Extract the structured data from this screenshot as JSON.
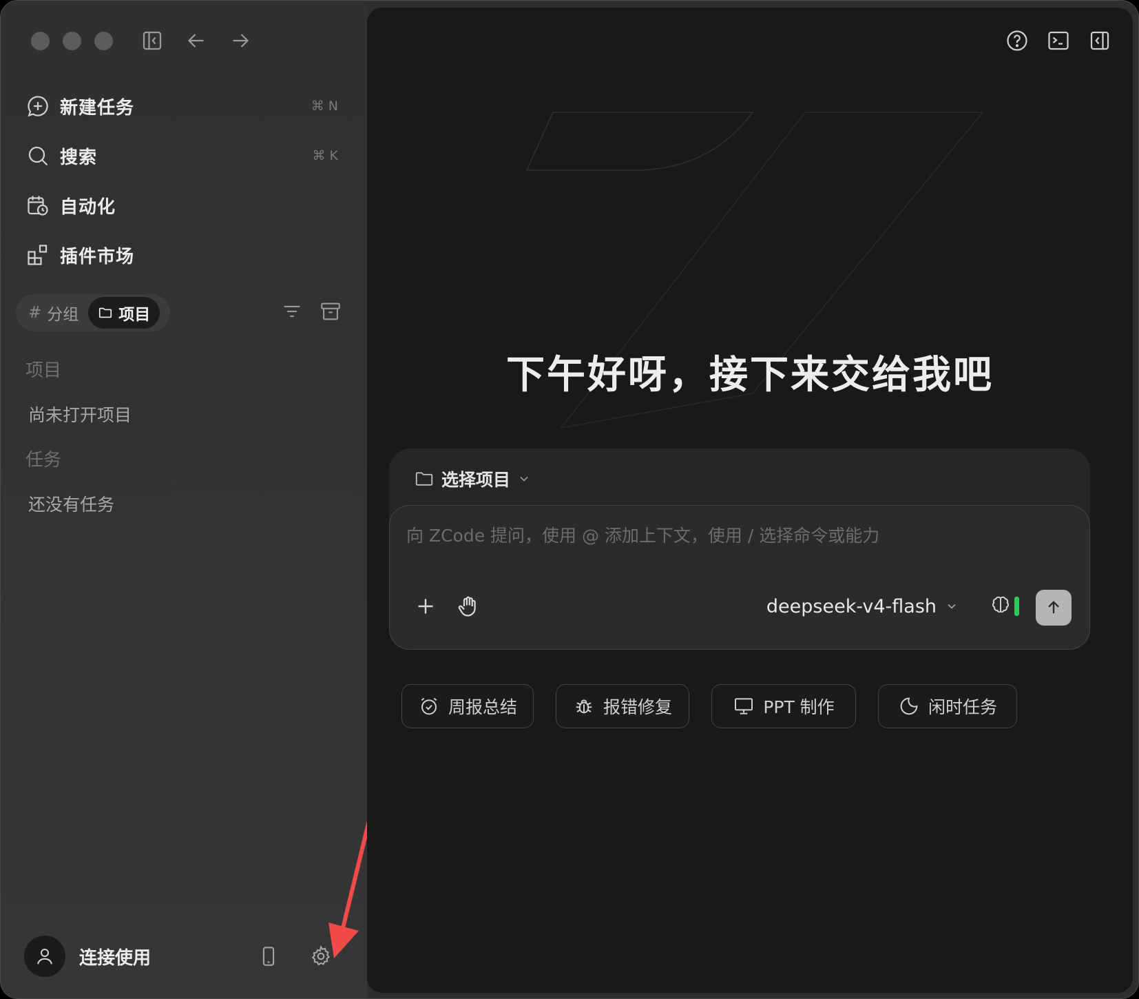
{
  "sidebar": {
    "nav": [
      {
        "label": "新建任务",
        "shortcut": "⌘ N",
        "icon": "new-task-icon"
      },
      {
        "label": "搜索",
        "shortcut": "⌘ K",
        "icon": "search-icon"
      },
      {
        "label": "自动化",
        "shortcut": "",
        "icon": "calendar-clock-icon"
      },
      {
        "label": "插件市场",
        "shortcut": "",
        "icon": "plugin-grid-icon"
      }
    ],
    "segment": {
      "group_label": "分组",
      "project_label": "项目",
      "active": "项目"
    },
    "projects_title": "项目",
    "projects_empty": "尚未打开项目",
    "tasks_title": "任务",
    "tasks_empty": "还没有任务",
    "account_label": "连接使用"
  },
  "main": {
    "greeting": "下午好呀，接下来交给我吧",
    "composer": {
      "project_select": "选择项目",
      "placeholder": "向 ZCode 提问，使用 @ 添加上下文，使用 / 选择命令或能力",
      "model": "deepseek-v4-flash"
    },
    "suggestions": [
      {
        "label": "周报总结",
        "icon": "alarm-clock-icon"
      },
      {
        "label": "报错修复",
        "icon": "bug-icon"
      },
      {
        "label": "PPT 制作",
        "icon": "presentation-icon"
      },
      {
        "label": "闲时任务",
        "icon": "moon-icon"
      }
    ]
  },
  "colors": {
    "accent_green": "#2ecc5a",
    "annotation_arrow": "#f04a4a"
  }
}
